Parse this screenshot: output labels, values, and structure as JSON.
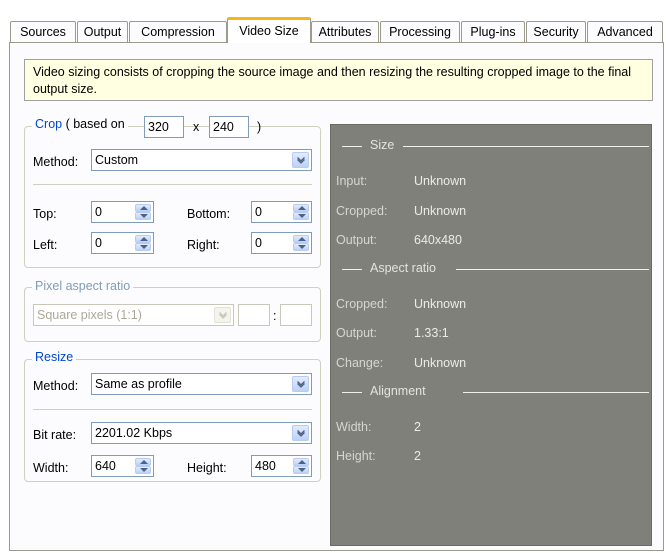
{
  "tabs": [
    "Sources",
    "Output",
    "Compression",
    "Video Size",
    "Attributes",
    "Processing",
    "Plug-ins",
    "Security",
    "Advanced"
  ],
  "info_text": "Video sizing consists of cropping the source image and then resizing the resulting cropped image to the final output size.",
  "crop": {
    "legend_prefix": "Crop",
    "based_on": "( based on",
    "width": "320",
    "x": "x",
    "height": "240",
    "close": ")",
    "method_label": "Method:",
    "method_value": "Custom",
    "top_label": "Top:",
    "top_value": "0",
    "bottom_label": "Bottom:",
    "bottom_value": "0",
    "left_label": "Left:",
    "left_value": "0",
    "right_label": "Right:",
    "right_value": "0"
  },
  "pixel_aspect": {
    "legend": "Pixel aspect ratio",
    "value": "Square pixels (1:1)",
    "colon": ":"
  },
  "resize": {
    "legend": "Resize",
    "method_label": "Method:",
    "method_value": "Same as profile",
    "bitrate_label": "Bit rate:",
    "bitrate_value": "2201.02 Kbps",
    "width_label": "Width:",
    "width_value": "640",
    "height_label": "Height:",
    "height_value": "480"
  },
  "summary": {
    "size_header": "Size",
    "input_label": "Input:",
    "input_value": "Unknown",
    "cropped_label": "Cropped:",
    "cropped_value": "Unknown",
    "output_label": "Output:",
    "output_value": "640x480",
    "aspect_header": "Aspect ratio",
    "a_cropped_label": "Cropped:",
    "a_cropped_value": "Unknown",
    "a_output_label": "Output:",
    "a_output_value": "1.33:1",
    "change_label": "Change:",
    "change_value": "Unknown",
    "align_header": "Alignment",
    "width_label": "Width:",
    "width_value": "2",
    "height_label": "Height:",
    "height_value": "2"
  },
  "colors": {
    "active_tab_accent": "#f8b418",
    "legend": "#0046d5",
    "info_bg": "#ffffe1",
    "summary_bg": "#7f8079"
  },
  "icons": {
    "dropdown": "chevron-down-icon",
    "spinner": "spin-arrows-icon"
  }
}
